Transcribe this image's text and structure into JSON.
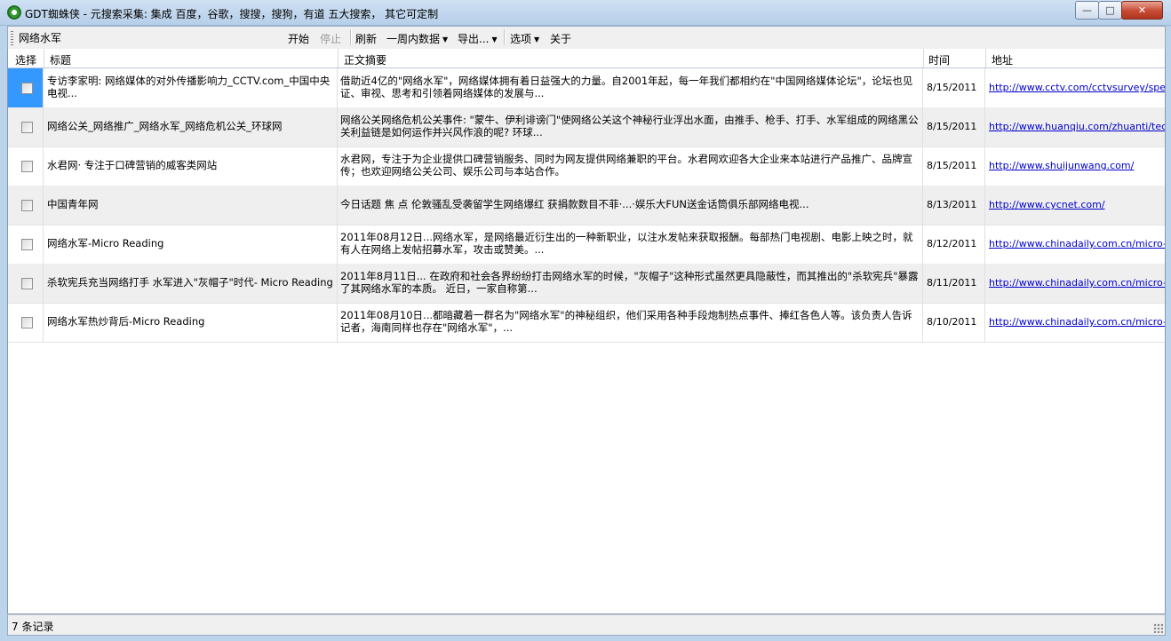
{
  "window": {
    "title": "GDT蜘蛛侠 - 元搜索采集: 集成 百度，谷歌，搜搜，搜狗，有道 五大搜索， 其它可定制",
    "min_glyph": "—",
    "max_glyph": "□",
    "close_glyph": "✕"
  },
  "toolbar": {
    "search_value": "网络水军",
    "start_label": "开始",
    "stop_label": "停止",
    "refresh_label": "刷新",
    "range_label": "一周内数据",
    "export_label": "导出...",
    "options_label": "选项",
    "about_label": "关于"
  },
  "grid": {
    "headers": [
      "选择",
      "标题",
      "正文摘要",
      "时间",
      "地址"
    ],
    "rows": [
      {
        "title": "专访李家明: 网络媒体的对外传播影响力_CCTV.com_中国中央电视...",
        "summary": "借助近4亿的\"网络水军\"，网络媒体拥有着日益强大的力量。自2001年起，每一年我们都相约在\"中国网络媒体论坛\"，论坛也见证、审视、思考和引领着网络媒体的发展与...",
        "time": "8/15/2011",
        "url": "http://www.cctv.com/cctvsurvey/special"
      },
      {
        "title": "网络公关_网络推广_网络水军_网络危机公关_环球网",
        "summary": "网络公关网络危机公关事件: \"蒙牛、伊利诽谤门\"使网络公关这个神秘行业浮出水面，由推手、枪手、打手、水军组成的网络黑公关利益链是如何运作并兴风作浪的呢? 环球...",
        "time": "8/15/2011",
        "url": "http://www.huanqiu.com/zhuanti/tech/p"
      },
      {
        "title": "水君网· 专注于口碑营销的威客类网站",
        "summary": "水君网，专注于为企业提供口碑营销服务、同时为网友提供网络兼职的平台。水君网欢迎各大企业来本站进行产品推广、品牌宣传；也欢迎网络公关公司、娱乐公司与本站合作。",
        "time": "8/15/2011",
        "url": "http://www.shuijunwang.com/"
      },
      {
        "title": "中国青年网",
        "summary": "今日话题 焦 点 伦敦骚乱受袭留学生网络爆红 获捐款数目不菲·...·娱乐大FUN送金话筒俱乐部网络电视...",
        "time": "8/13/2011",
        "url": "http://www.cycnet.com/"
      },
      {
        "title": "网络水军-Micro Reading",
        "summary": "2011年08月12日...网络水军，是网络最近衍生出的一种新职业，以注水发帖来获取报酬。每部热门电视剧、电影上映之时，就有人在网络上发帖招募水军，攻击或赞美。...",
        "time": "8/12/2011",
        "url": "http://www.chinadaily.com.cn/micro-read"
      },
      {
        "title": "杀软宪兵充当网络打手 水军进入\"灰帽子\"时代- Micro Reading",
        "summary": "2011年8月11日... 在政府和社会各界纷纷打击网络水军的时候，\"灰帽子\"这种形式虽然更具隐蔽性，而其推出的\"杀软宪兵\"暴露了其网络水军的本质。 近日，一家自称第...",
        "time": "8/11/2011",
        "url": "http://www.chinadaily.com.cn/micro-read"
      },
      {
        "title": "网络水军热炒背后-Micro Reading",
        "summary": "2011年08月10日...都暗藏着一群名为\"网络水军\"的神秘组织，他们采用各种手段炮制热点事件、捧红各色人等。该负责人告诉记者，海南同样也存在\"网络水军\"，...",
        "time": "8/10/2011",
        "url": "http://www.chinadaily.com.cn/micro-read"
      }
    ]
  },
  "status": {
    "text": "7 条记录"
  },
  "icons": {
    "app": "app-logo-icon",
    "dropdown": "chevron-down-icon"
  }
}
